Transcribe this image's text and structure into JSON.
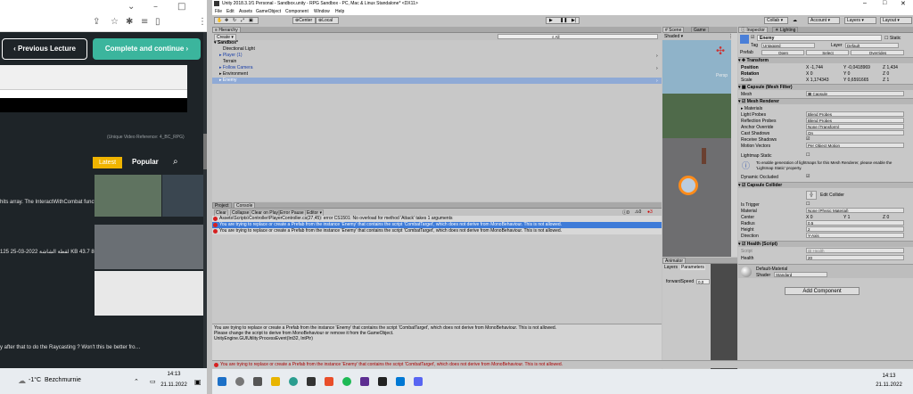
{
  "browser": {
    "prev_label": "Previous Lecture",
    "next_label": "Complete and continue",
    "video_ref": "(Unique Video Reference: 4_BC_RPG)",
    "latest": "Latest",
    "popular": "Popular",
    "post1": "hits array. The InteractWithCombat function is getting cal…",
    "post2": "125 25-03-2022 لقطة الشاشة KB 43.7 866×144424936 25-03…",
    "post3": "y after that to do the Raycasting ? Won't this be better fro…"
  },
  "taskbar_left": {
    "weather": "-1°C",
    "location": "Bezchmurnie",
    "time": "14:13",
    "date": "21.11.2022"
  },
  "taskbar_right": {
    "time": "14:13",
    "date": "21.11.2022"
  },
  "unity": {
    "title": "Unity 2018.3.1f1 Personal - Sandbox.unity - RPG Sandbox - PC, Mac & Linux Standalone* <DX11>",
    "menu": [
      "File",
      "Edit",
      "Assets",
      "GameObject",
      "Component",
      "Window",
      "Help"
    ],
    "center": "Center",
    "local": "Local",
    "collab": "Collab",
    "account": "Account",
    "layers": "Layers",
    "layout": "Layout",
    "hierarchy": {
      "tab": "Hierarchy",
      "create": "Create",
      "search": "All",
      "scene": "Sandbox*",
      "items": [
        "Directional Light",
        "Player (1)",
        "Terrain",
        "Follow Camera",
        "Environment",
        "Enemy"
      ]
    },
    "scene": {
      "tab_scene": "Scene",
      "tab_game": "Game",
      "shaded": "Shaded",
      "persp": "Persp"
    },
    "console": {
      "tab_project": "Project",
      "tab_console": "Console",
      "clear": "Clear",
      "collapse": "Collapse",
      "clear_on_play": "Clear on Play",
      "error_pause": "Error Pause",
      "editor": "Editor",
      "count_warn": "0",
      "count_info": "0",
      "count_err": "3",
      "messages": [
        "Assets\\Scripts\\Controller\\PlayerController.cs(27,45): error CS1501: No overload for method 'Attack' takes 1 arguments",
        "You are trying to replace or create a Prefab from the instance 'Enemy' that contains the script 'CombatTarget', which does not derive from MonoBehaviour. This is not allowed.",
        "You are trying to replace or create a Prefab from the instance 'Enemy' that contains the script 'CombatTarget', which does not derive from MonoBehaviour. This is not allowed."
      ],
      "detail": [
        "You are trying to replace or create a Prefab from the instance 'Enemy' that contains the script 'CombatTarget', which does not derive from MonoBehaviour. This is not allowed.",
        "Please change the script to derive from MonoBehaviour or remove it from the GameObject.",
        "UnityEngine.GUIUtility:ProcessEvent(Int32, IntPtr)"
      ],
      "status": "You are trying to replace or create a Prefab from the instance 'Enemy' that contains the script 'CombatTarget', which does not derive from MonoBehaviour. This is not allowed."
    },
    "animator": {
      "tab": "Animator",
      "layers": "Layers",
      "parameters": "Parameters",
      "param": "forwardSpeed",
      "value": "0,0"
    },
    "inspector": {
      "tab": "Inspector",
      "tab2": "Lighting",
      "name": "Enemy",
      "static": "Static",
      "tag_label": "Tag",
      "tag": "Untagged",
      "layer_label": "Layer",
      "layer": "Default",
      "prefab": "Prefab",
      "open": "Open",
      "select": "Select",
      "overrides": "Overrides",
      "transform": "Transform",
      "position": "Position",
      "pos_x": "-1,744",
      "pos_y": "-0,0418969",
      "pos_z": "1,434",
      "rotation": "Rotation",
      "rot_x": "0",
      "rot_y": "0",
      "rot_z": "0",
      "scale": "Scale",
      "sc_x": "1,174343",
      "sc_y": "0,6591665",
      "sc_z": "1",
      "mesh_filter": "Capsule (Mesh Filter)",
      "mesh_label": "Mesh",
      "mesh": "Capsule",
      "mesh_renderer": "Mesh Renderer",
      "materials": "Materials",
      "light_probes": "Light Probes",
      "light_probes_v": "Blend Probes",
      "refl_probes": "Reflection Probes",
      "refl_probes_v": "Blend Probes",
      "anchor": "Anchor Override",
      "anchor_v": "None (Transform)",
      "cast": "Cast Shadows",
      "cast_v": "On",
      "receive": "Receive Shadows",
      "motion": "Motion Vectors",
      "motion_v": "Per Object Motion",
      "lightmap": "Lightmap Static",
      "lightmap_info": "To enable generation of lightmaps for this Mesh Renderer, please enable the 'Lightmap Static' property.",
      "dyn": "Dynamic Occluded",
      "collider": "Capsule Collider",
      "edit_collider": "Edit Collider",
      "trigger": "Is Trigger",
      "material": "Material",
      "material_v": "None (Physic Material)",
      "center": "Center",
      "c_x": "0",
      "c_y": "1",
      "c_z": "0",
      "radius": "Radius",
      "radius_v": "0.5",
      "height": "Height",
      "height_v": "2",
      "direction": "Direction",
      "direction_v": "Y-Axis",
      "health": "Health (Script)",
      "script": "Script",
      "script_v": "Health",
      "health_label": "Health",
      "health_v": "20",
      "material_name": "Default-Material",
      "shader": "Shader",
      "shader_v": "Standard",
      "add_component": "Add Component"
    }
  }
}
